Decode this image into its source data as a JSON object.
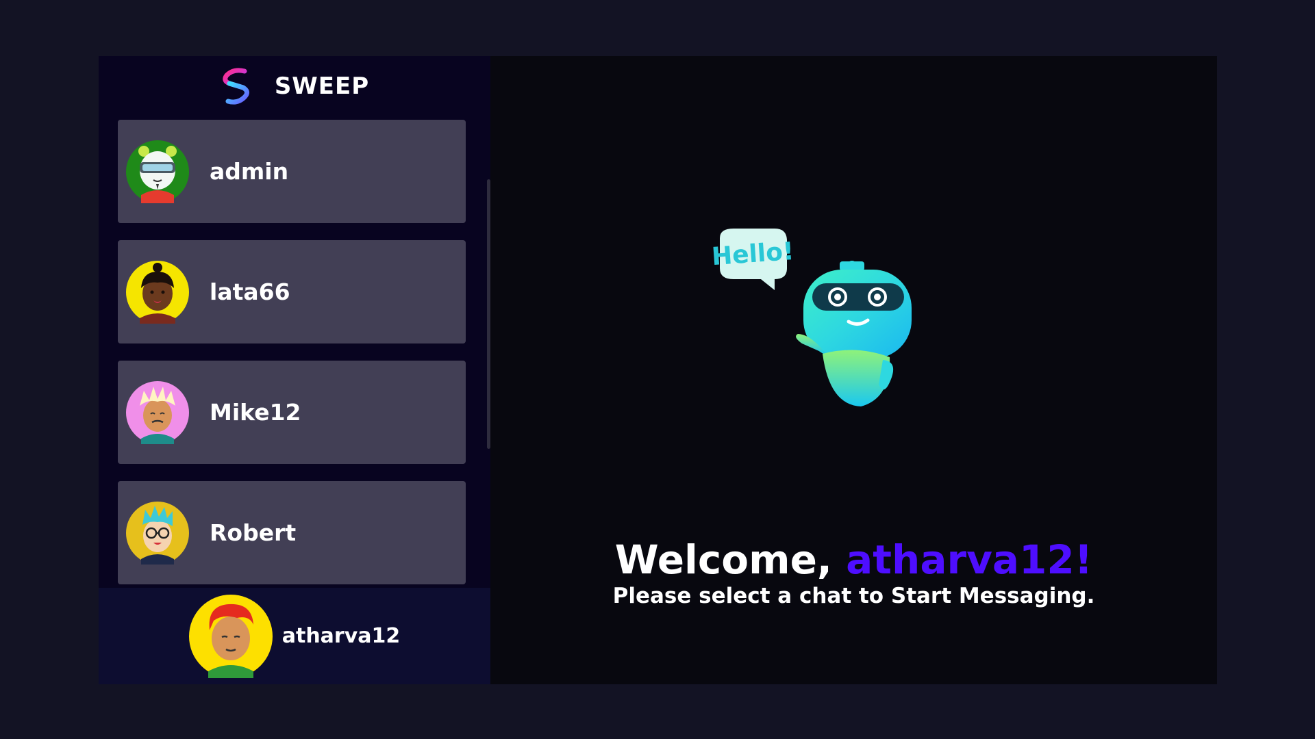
{
  "app": {
    "brand_name": "SWEEP"
  },
  "contacts": [
    {
      "username": "admin",
      "avatar_icon": "panda-vr-avatar-icon",
      "avatar_bg": "#1f8a19"
    },
    {
      "username": "lata66",
      "avatar_icon": "woman-avatar-icon",
      "avatar_bg": "#f5e500"
    },
    {
      "username": "Mike12",
      "avatar_icon": "man-spiky-hair-avatar-icon",
      "avatar_bg": "#f08fe9"
    },
    {
      "username": "Robert",
      "avatar_icon": "man-glasses-avatar-icon",
      "avatar_bg": "#e6c01c"
    }
  ],
  "current_user": {
    "username": "atharva12",
    "avatar_icon": "man-red-hair-avatar-icon",
    "avatar_bg": "#fde000"
  },
  "welcome": {
    "greeting": "Welcome,",
    "username": "atharva12!",
    "subtitle": "Please select a chat to Start Messaging.",
    "bubble_text": "Hello!"
  },
  "colors": {
    "page_bg": "#131324",
    "sidebar_bg": "#080420",
    "contact_bg": "#423f55",
    "current_user_bg": "#0d0d30",
    "accent": "#4e0eff"
  }
}
